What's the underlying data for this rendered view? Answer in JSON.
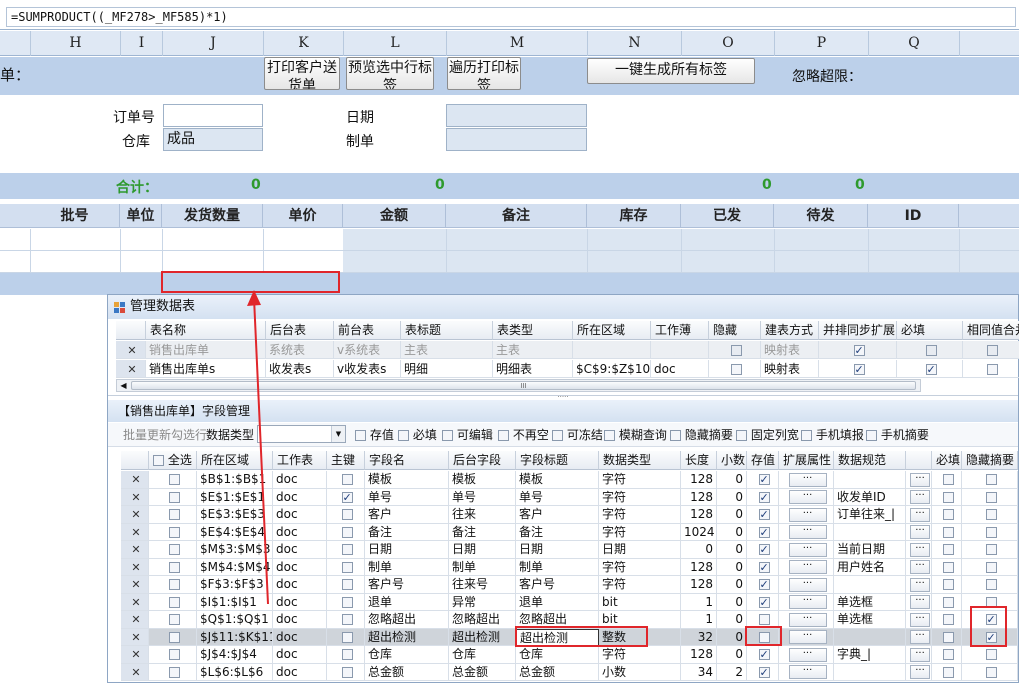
{
  "formula": "=SUMPRODUCT((_MF278>_MF585)*1)",
  "columns": [
    "H",
    "I",
    "J",
    "K",
    "L",
    "M",
    "N",
    "O",
    "P",
    "Q"
  ],
  "sheet": {
    "left_label": "单：",
    "buttons": [
      "打印客户送货单",
      "预览选中行标签",
      "遍历打印标签",
      "一键生成所有标签"
    ],
    "ignore_label": "忽略超限：",
    "order_no_label": "订单号",
    "warehouse_label": "仓库",
    "warehouse_value": "成品",
    "date_label": "日期",
    "maker_label": "制单",
    "total_label": "合计：",
    "totals": [
      "0",
      "0",
      "0",
      "0"
    ],
    "headers": [
      "批号",
      "单位",
      "发货数量",
      "单价",
      "金额",
      "备注",
      "库存",
      "已发",
      "待发",
      "ID"
    ]
  },
  "dialog": {
    "title": "管理数据表",
    "table_headers": [
      "表名称",
      "后台表",
      "前台表",
      "表标题",
      "表类型",
      "所在区域",
      "工作薄",
      "隐藏",
      "建表方式",
      "并排同步扩展",
      "必填",
      "相同值合并"
    ],
    "table_rows": [
      {
        "name": "销售出库单",
        "backend": "系统表",
        "frontend": "v系统表",
        "title": "主表",
        "type": "主表",
        "region": "",
        "workbook": "",
        "hidden": false,
        "mode": "映射表",
        "sync": true,
        "required": false,
        "merge": false,
        "dim": true
      },
      {
        "name": "销售出库单s",
        "backend": "收发表s",
        "frontend": "v收发表s",
        "title": "明细",
        "type": "明细表",
        "region": "$C$9:$Z$10",
        "workbook": "doc",
        "hidden": false,
        "mode": "映射表",
        "sync": true,
        "required": true,
        "merge": false,
        "dim": false
      }
    ],
    "scroll_mark": "III",
    "field_section_title": "【销售出库单】字段管理",
    "toolbar": {
      "batch_update": "批量更新勾选行",
      "data_type_label": "数据类型",
      "options": [
        "存值",
        "必填",
        "可编辑",
        "不再空",
        "可冻结",
        "模糊查询",
        "隐藏摘要",
        "固定列宽",
        "手机填报",
        "手机摘要"
      ]
    },
    "field_headers": [
      "全选",
      "所在区域",
      "工作表",
      "主键",
      "字段名",
      "后台字段",
      "字段标题",
      "数据类型",
      "长度",
      "小数",
      "存值",
      "扩展属性",
      "数据规范",
      "必填",
      "隐藏摘要"
    ],
    "field_rows": [
      {
        "region": "$B$1:$B$1",
        "sheet": "doc",
        "pk": false,
        "name": "模板",
        "back": "模板",
        "title": "模板",
        "type": "字符",
        "len": "128",
        "dec": "0",
        "store": true,
        "spec": "",
        "hide": false
      },
      {
        "region": "$E$1:$E$1",
        "sheet": "doc",
        "pk": true,
        "name": "单号",
        "back": "单号",
        "title": "单号",
        "type": "字符",
        "len": "128",
        "dec": "0",
        "store": true,
        "spec": "收发单ID",
        "hide": false
      },
      {
        "region": "$E$3:$E$3",
        "sheet": "doc",
        "pk": false,
        "name": "客户",
        "back": "往来",
        "title": "客户",
        "type": "字符",
        "len": "128",
        "dec": "0",
        "store": true,
        "spec": "订单往来_|",
        "hide": false
      },
      {
        "region": "$E$4:$E$4",
        "sheet": "doc",
        "pk": false,
        "name": "备注",
        "back": "备注",
        "title": "备注",
        "type": "字符",
        "len": "1024",
        "dec": "0",
        "store": true,
        "spec": "",
        "hide": false
      },
      {
        "region": "$M$3:$M$3",
        "sheet": "doc",
        "pk": false,
        "name": "日期",
        "back": "日期",
        "title": "日期",
        "type": "日期",
        "len": "0",
        "dec": "0",
        "store": true,
        "spec": "当前日期",
        "hide": false
      },
      {
        "region": "$M$4:$M$4",
        "sheet": "doc",
        "pk": false,
        "name": "制单",
        "back": "制单",
        "title": "制单",
        "type": "字符",
        "len": "128",
        "dec": "0",
        "store": true,
        "spec": "用户姓名",
        "hide": false
      },
      {
        "region": "$F$3:$F$3",
        "sheet": "doc",
        "pk": false,
        "name": "客户号",
        "back": "往来号",
        "title": "客户号",
        "type": "字符",
        "len": "128",
        "dec": "0",
        "store": true,
        "spec": "",
        "hide": false
      },
      {
        "region": "$I$1:$I$1",
        "sheet": "doc",
        "pk": false,
        "name": "退单",
        "back": "异常",
        "title": "退单",
        "type": "bit",
        "len": "1",
        "dec": "0",
        "store": true,
        "spec": "单选框",
        "hide": false
      },
      {
        "region": "$Q$1:$Q$1",
        "sheet": "doc",
        "pk": false,
        "name": "忽略超出",
        "back": "忽略超出",
        "title": "忽略超出",
        "type": "bit",
        "len": "1",
        "dec": "0",
        "store": false,
        "spec": "单选框",
        "hide": true
      },
      {
        "region": "$J$11:$K$11",
        "sheet": "doc",
        "pk": false,
        "name": "超出检测",
        "back": "超出检测",
        "title": "超出检测",
        "type": "整数",
        "len": "32",
        "dec": "0",
        "store": false,
        "spec": "",
        "hide": true,
        "selected": true
      },
      {
        "region": "$J$4:$J$4",
        "sheet": "doc",
        "pk": false,
        "name": "仓库",
        "back": "仓库",
        "title": "仓库",
        "type": "字符",
        "len": "128",
        "dec": "0",
        "store": true,
        "spec": "字典_|",
        "hide": false
      },
      {
        "region": "$L$6:$L$6",
        "sheet": "doc",
        "pk": false,
        "name": "总金额",
        "back": "总金额",
        "title": "总金额",
        "type": "小数",
        "len": "34",
        "dec": "2",
        "store": true,
        "spec": "",
        "hide": false
      }
    ]
  }
}
